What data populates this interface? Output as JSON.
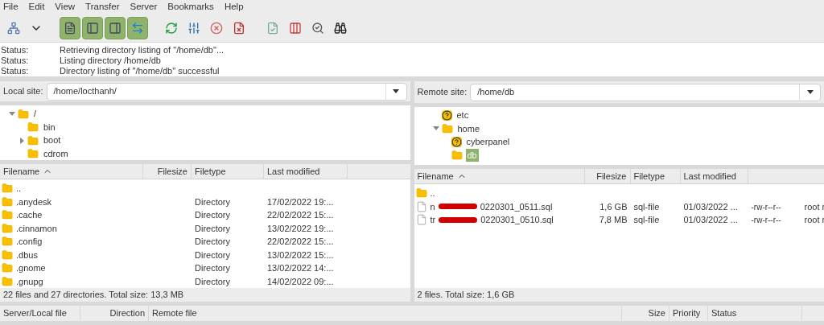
{
  "menu": [
    "File",
    "Edit",
    "View",
    "Transfer",
    "Server",
    "Bookmarks",
    "Help"
  ],
  "toolbar": [
    {
      "kind": "sitemanager",
      "selected": false
    },
    {
      "kind": "dropdown",
      "selected": false
    },
    {
      "kind": "log",
      "selected": true
    },
    {
      "kind": "localtree",
      "selected": true
    },
    {
      "kind": "remotetree",
      "selected": true
    },
    {
      "kind": "queue",
      "selected": true
    },
    {
      "kind": "refresh",
      "selected": false
    },
    {
      "kind": "filters",
      "selected": false
    },
    {
      "kind": "cancel",
      "selected": false
    },
    {
      "kind": "disconnect",
      "selected": false
    },
    {
      "kind": "reconnect",
      "selected": false
    },
    {
      "kind": "compare",
      "selected": false
    },
    {
      "kind": "sync",
      "selected": false
    },
    {
      "kind": "search",
      "selected": false
    }
  ],
  "log": [
    {
      "label": "Status:",
      "message": "Retrieving directory listing of \"/home/db\"..."
    },
    {
      "label": "Status:",
      "message": "Listing directory /home/db"
    },
    {
      "label": "Status:",
      "message": "Directory listing of \"/home/db\" successful"
    }
  ],
  "local": {
    "site_label": "Local site:",
    "path": "/home/locthanh/",
    "tree": [
      {
        "name": "/",
        "kind": "folder",
        "expanded": true,
        "selected": false,
        "children": [
          {
            "name": "bin",
            "kind": "folder",
            "expanded": false,
            "selected": false
          },
          {
            "name": "boot",
            "kind": "folder",
            "expanded": false,
            "has_children": true,
            "selected": false
          },
          {
            "name": "cdrom",
            "kind": "folder",
            "expanded": false,
            "selected": false
          }
        ]
      }
    ],
    "columns": [
      "Filename",
      "Filesize",
      "Filetype",
      "Last modified"
    ],
    "rows": [
      {
        "name": "..",
        "size": "",
        "type": "",
        "modified": ""
      },
      {
        "name": ".anydesk",
        "type": "Directory",
        "modified": "17/02/2022 19:..."
      },
      {
        "name": ".cache",
        "type": "Directory",
        "modified": "22/02/2022 15:..."
      },
      {
        "name": ".cinnamon",
        "type": "Directory",
        "modified": "13/02/2022 19:..."
      },
      {
        "name": ".config",
        "type": "Directory",
        "modified": "22/02/2022 15:..."
      },
      {
        "name": ".dbus",
        "type": "Directory",
        "modified": "13/02/2022 15:..."
      },
      {
        "name": ".gnome",
        "type": "Directory",
        "modified": "13/02/2022 14:..."
      },
      {
        "name": ".gnupg",
        "type": "Directory",
        "modified": "14/02/2022 09:..."
      }
    ],
    "status": "22 files and 27 directories. Total size: 13,3 MB"
  },
  "remote": {
    "site_label": "Remote site:",
    "path": "/home/db",
    "tree": [
      {
        "name": "etc",
        "kind": "unknown",
        "expanded": false,
        "selected": false
      },
      {
        "name": "home",
        "kind": "folder",
        "expanded": true,
        "selected": false,
        "children": [
          {
            "name": "cyberpanel",
            "kind": "unknown",
            "expanded": false,
            "selected": false
          },
          {
            "name": "db",
            "kind": "folder",
            "expanded": false,
            "selected": true
          }
        ]
      }
    ],
    "columns": [
      "Filename",
      "Filesize",
      "Filetype",
      "Last modified"
    ],
    "rows": [
      {
        "name": "..",
        "kind": "folder"
      },
      {
        "kind": "file",
        "name_start": "n",
        "name_end": "0220301_0511.sql",
        "size": "1,6 GB",
        "type": "sql-file",
        "modified": "01/03/2022 ...",
        "column_5": "-rw-r--r--",
        "column_6": "root r"
      },
      {
        "kind": "file",
        "name_start": "tr",
        "name_end": "0220301_0510.sql",
        "size": "7,8 MB",
        "type": "sql-file",
        "modified": "01/03/2022 ...",
        "column_5": "-rw-r--r--",
        "column_6": "root r"
      }
    ],
    "status": "2 files. Total size: 1,6 GB"
  },
  "queue_columns": [
    "Server/Local file",
    "Direction",
    "Remote file",
    "Size",
    "Priority",
    "Status"
  ]
}
